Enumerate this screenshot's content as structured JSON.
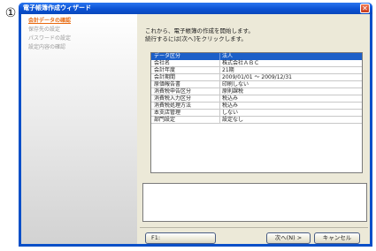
{
  "step_number": "①",
  "window": {
    "title": "電子帳簿作成ウィザード",
    "close_glyph": "✕"
  },
  "steps": [
    {
      "label": "会計データの確認",
      "active": true
    },
    {
      "label": "保存先の設定",
      "active": false
    },
    {
      "label": "パスワードの設定",
      "active": false
    },
    {
      "label": "設定内容の確認",
      "active": false
    }
  ],
  "intro": {
    "line1": "これから、電子帳簿の作成を開始します。",
    "line2": "続行するには[次へ]をクリックします。"
  },
  "table": {
    "header": {
      "label": "データ区分",
      "value": "法人"
    },
    "rows": [
      {
        "label": "会社名",
        "value": "株式会社ＡＢＣ"
      },
      {
        "label": "会計年度",
        "value": "21期"
      },
      {
        "label": "会計期間",
        "value": "2009/01/01 ～ 2009/12/31"
      },
      {
        "label": "原価報告書",
        "value": "印刷しない"
      },
      {
        "label": "消費税申告区分",
        "value": "原則課税"
      },
      {
        "label": "消費税入力区分",
        "value": "税込み"
      },
      {
        "label": "消費税処理方法",
        "value": "税込み"
      },
      {
        "label": "本支店管理",
        "value": "しない"
      },
      {
        "label": "部門設定",
        "value": "設定なし"
      }
    ]
  },
  "buttons": {
    "f1": "F1:",
    "next": "次へ(N) >",
    "cancel": "キャンセル"
  },
  "colors": {
    "title_bar": "#0b52d4",
    "active_step": "#e86a10",
    "table_header": "#1c5fc8"
  }
}
